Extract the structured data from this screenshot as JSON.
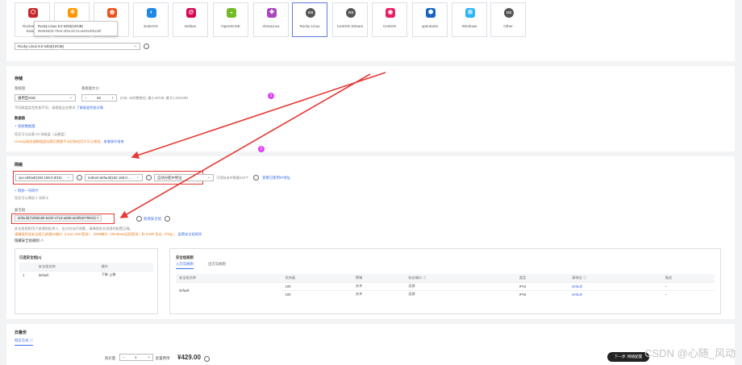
{
  "os_cards": [
    {
      "label": "RockeLinux\nEulerO",
      "icon": "hexagon-icon",
      "color": "#c62828",
      "glyph": "⬡"
    },
    {
      "label": "",
      "icon": "pinwheel-icon",
      "color": "#ff9800",
      "glyph": "✲"
    },
    {
      "label": "",
      "icon": "ubuntu-icon",
      "color": "#e95420",
      "glyph": "◍"
    },
    {
      "label": "EulerOS",
      "icon": "euleros-icon",
      "color": "#1e88e5",
      "glyph": "◐"
    },
    {
      "label": "Debian",
      "icon": "debian-icon",
      "color": "#d70751",
      "glyph": "@"
    },
    {
      "label": "OpenSUSE",
      "icon": "opensuse-icon",
      "color": "#73ba25",
      "glyph": "◒"
    },
    {
      "label": "AlmaLinux",
      "icon": "almalinux-icon",
      "color": "#ab47bc",
      "glyph": "✤"
    },
    {
      "label": "Rocky Linux",
      "icon": "rocky-icon",
      "color": "#555555",
      "glyph": "OS",
      "selected": true
    },
    {
      "label": "CentOS Stream",
      "icon": "centos-stream-icon",
      "color": "#555555",
      "glyph": "OS"
    },
    {
      "label": "CentOS",
      "icon": "centos-icon",
      "color": "#e91e63",
      "glyph": "◉"
    },
    {
      "label": "openEuler",
      "icon": "openeuler-icon",
      "color": "#1565c0",
      "glyph": "⬢"
    },
    {
      "label": "Windows",
      "icon": "windows-icon",
      "color": "#29b6f6",
      "glyph": "⊞"
    },
    {
      "label": "Other",
      "icon": "other-os-icon",
      "color": "#555555",
      "glyph": "OS"
    }
  ],
  "tooltip": {
    "line1": "Rocky Linux 9.0 64bit(10GiB)",
    "line2": "953669d3-79e0-4f3a-817a-ae92c5f9130f"
  },
  "image_select": "Rocky Linux 9.0 64bit(10GiB)",
  "storage": {
    "title": "存储",
    "disk_type_label": "系统盘",
    "disk_type": "通用型SSD",
    "size_label": "系统盘大小",
    "size_value": "40",
    "size_unit": "GiB",
    "size_hint": "(GiB, 10的整数倍, 最小40GiB, 最大1,024GiB)",
    "disk_hint": "不同磁盘类型性能不同，请根据业务需求 ",
    "disk_hint_link": "了解磁盘性能详情",
    "data_disk_title": "数据盘",
    "add_data_disk": "+ 添加数据盘",
    "data_disk_count": "您还可以挂载 23 块磁盘（云硬盘）",
    "warn": "Linux云服务器数据盘挂载后需要手动初始化后才可以使用。",
    "warn_link": "查看操作指南"
  },
  "network": {
    "title": "网络",
    "vpc": "vpc-default(192.168.0.0/16)",
    "subnet": "subnet-default(192.168.0.…",
    "ip_mode": "自动分配IP地址",
    "nic_hint": "可用私有IP数量243个",
    "view_link": "查看已使用IP地址",
    "add_nic": "+ 增加一块网卡",
    "nic_count": "您还可以增加 1 块网卡",
    "sg_title": "安全组",
    "sg_tag": "default(7189d185-5220-471d-a659-a04f53279823)",
    "sg_new": "新建安全组",
    "sg_hint": "安全组规则用于放通和拒绝入、出方向访问流量，请确保安全组规则配置正确。",
    "sg_warn": "请确保所选安全组已放通22端口（Linux SSH登录）、3389端口（Windows远程登录）和 ICMP 协议（Ping）。",
    "sg_warn_link": "配置安全组规则",
    "hide_rules": "隐藏安全组规则 ∧",
    "selected_title": "已选安全组(1)",
    "selected_cols": [
      "",
      "安全组名称",
      "操作"
    ],
    "selected_rows": [
      [
        "1",
        "default",
        "下移  上移"
      ]
    ],
    "rules_title": "安全组规则",
    "tabs": [
      "入方向规则",
      "出方向规则"
    ],
    "rule_cols": [
      "安全组名称",
      "优先级",
      "策略",
      "协议端口 ⓘ",
      "类型",
      "源地址 ⓘ",
      "描述"
    ],
    "rule_group": "default",
    "rule_rows": [
      [
        "100",
        "允许",
        "全部",
        "IPv4",
        "default",
        "--"
      ],
      [
        "100",
        "允许",
        "全部",
        "IPv6",
        "default",
        "--"
      ]
    ]
  },
  "bottom": {
    "title": "云备份",
    "backup_label": "购买方式 ⓘ",
    "qty_label": "购买量",
    "qty_value": "1",
    "price_label": "配置费用",
    "price": "¥429.00",
    "next": "下一步: 网络配置"
  },
  "markers": [
    "1",
    "2"
  ],
  "watermark": "CSDN @心随_风动"
}
